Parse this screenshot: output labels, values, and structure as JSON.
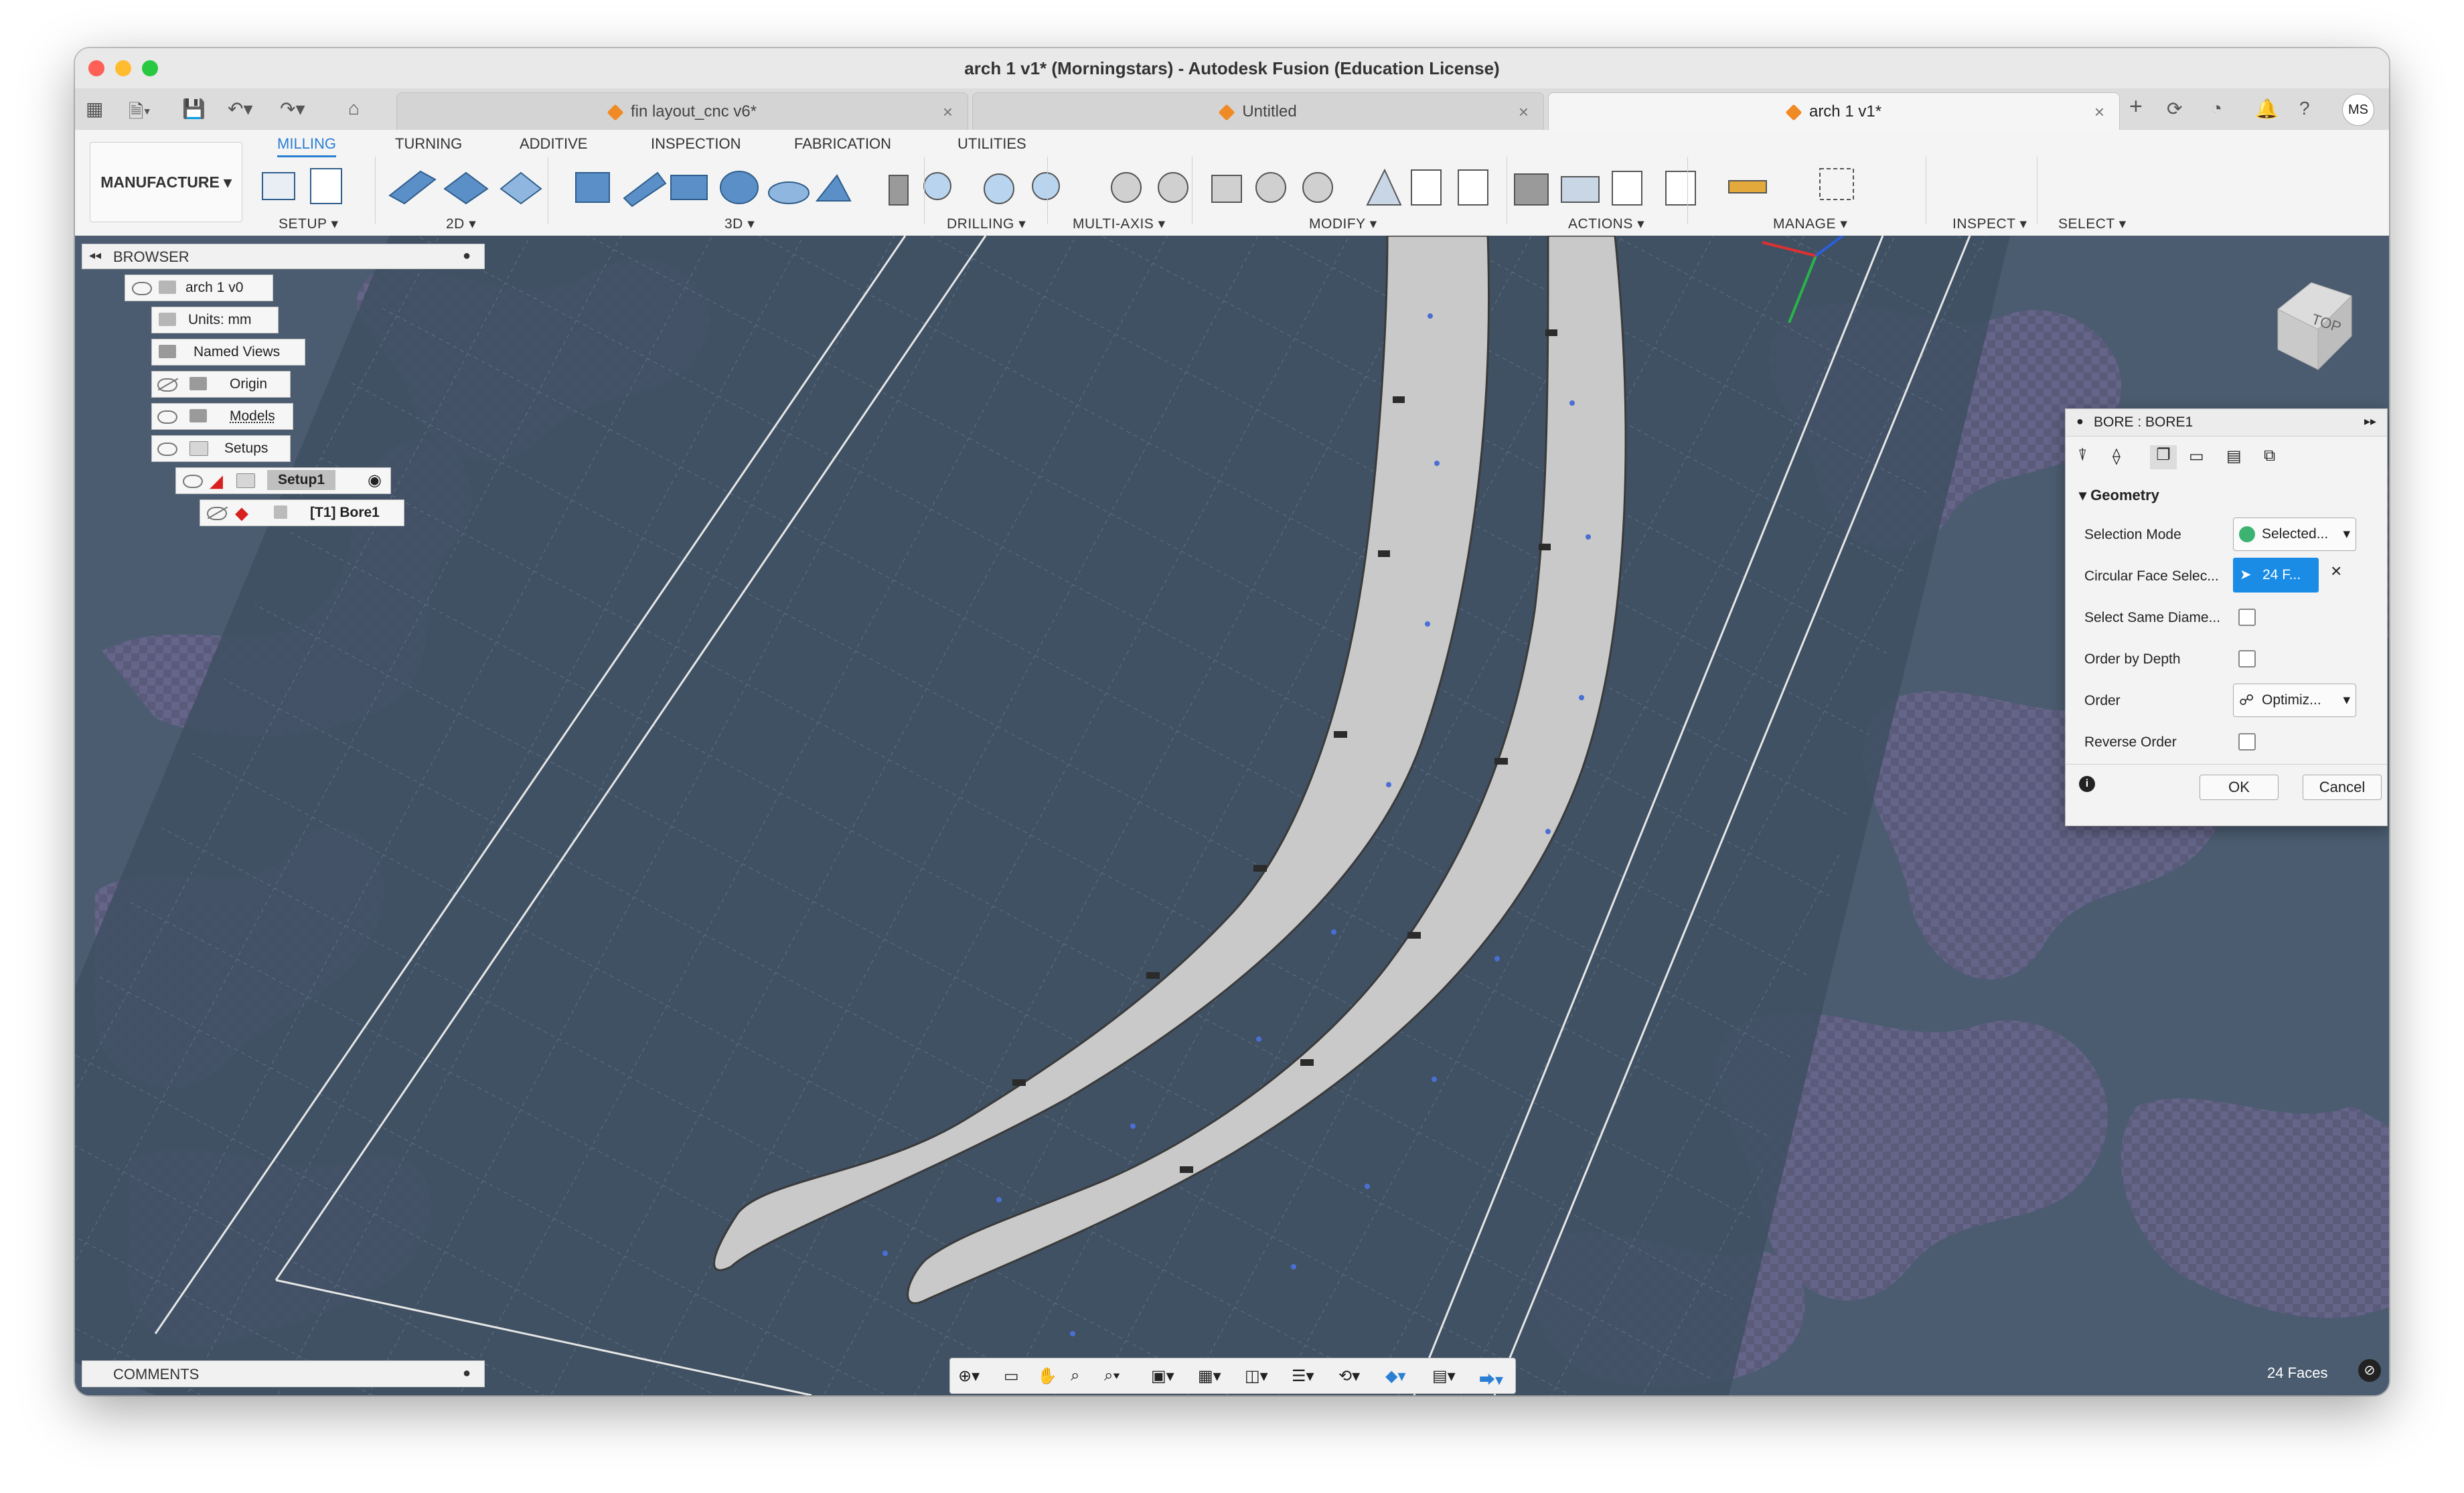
{
  "window": {
    "title": "arch 1 v1* (Morningstars) - Autodesk Fusion (Education License)"
  },
  "tabs": [
    {
      "label": "fin layout_cnc v6*",
      "active": false
    },
    {
      "label": "Untitled",
      "active": false
    },
    {
      "label": "arch 1 v1*",
      "active": true
    }
  ],
  "user": {
    "initials": "MS"
  },
  "ribbon": {
    "workspace": "MANUFACTURE",
    "tabs": [
      "MILLING",
      "TURNING",
      "ADDITIVE",
      "INSPECTION",
      "FABRICATION",
      "UTILITIES"
    ],
    "active_tab": "MILLING",
    "groups": [
      "SETUP",
      "2D",
      "3D",
      "DRILLING",
      "MULTI-AXIS",
      "MODIFY",
      "ACTIONS",
      "MANAGE",
      "INSPECT",
      "SELECT"
    ]
  },
  "browser": {
    "title": "BROWSER",
    "nodes": [
      "arch 1 v0",
      "Units: mm",
      "Named Views",
      "Origin",
      "Models",
      "Setups",
      "Setup1",
      "[T1] Bore1"
    ]
  },
  "comments": {
    "title": "COMMENTS"
  },
  "dialog": {
    "title": "BORE : BORE1",
    "section": "Geometry",
    "rows": {
      "selection_mode_label": "Selection Mode",
      "selection_mode_value": "Selected...",
      "circular_face_label": "Circular Face Selec...",
      "circular_face_value": "24 F...",
      "same_diameter_label": "Select Same Diame...",
      "order_by_depth_label": "Order by Depth",
      "order_label": "Order",
      "order_value": "Optimiz...",
      "reverse_order_label": "Reverse Order"
    },
    "ok": "OK",
    "cancel": "Cancel"
  },
  "viewcube": {
    "face": "TOP"
  },
  "status": {
    "selection": "24 Faces"
  },
  "colors": {
    "accent": "#2a7fd4",
    "viewport_bg": "#4a5a6d",
    "pattern": "#5b5a7a",
    "part": "#c8c8c8"
  }
}
